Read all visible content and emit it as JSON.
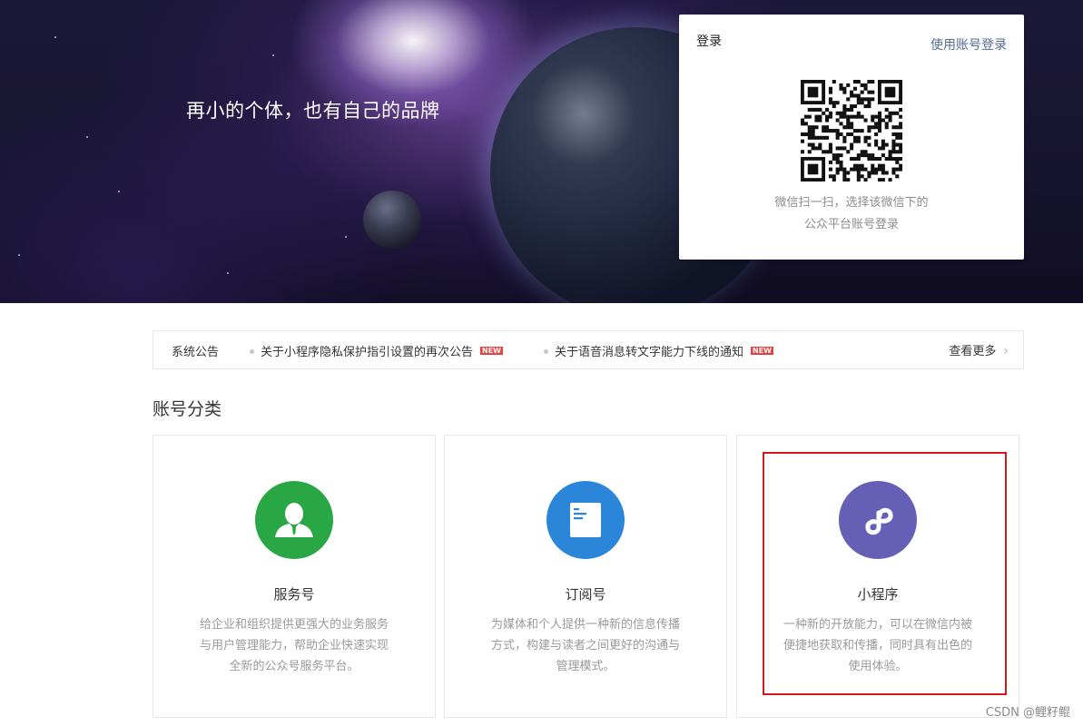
{
  "banner": {
    "slogan": "再小的个体，也有自己的品牌"
  },
  "login": {
    "title": "登录",
    "switch_link": "使用账号登录",
    "tip_line1": "微信扫一扫，选择该微信下的",
    "tip_line2": "公众平台账号登录"
  },
  "notice": {
    "label": "系统公告",
    "items": [
      {
        "text": "关于小程序隐私保护指引设置的再次公告",
        "tag": "NEW"
      },
      {
        "text": "关于语音消息转文字能力下线的通知",
        "tag": "NEW"
      }
    ],
    "more": "查看更多"
  },
  "section": {
    "title": "账号分类"
  },
  "cards": [
    {
      "name": "服务号",
      "icon": "user-suit-icon",
      "color": "#2aa745",
      "desc": [
        "给企业和组织提供更强大的业务服务",
        "与用户管理能力，帮助企业快速实现",
        "全新的公众号服务平台。"
      ]
    },
    {
      "name": "订阅号",
      "icon": "document-icon",
      "color": "#2b86da",
      "desc": [
        "为媒体和个人提供一种新的信息传播",
        "方式，构建与读者之间更好的沟通与",
        "管理模式。"
      ]
    },
    {
      "name": "小程序",
      "icon": "mini-program-icon",
      "color": "#6560b5",
      "desc": [
        "一种新的开放能力，可以在微信内被",
        "便捷地获取和传播，同时具有出色的",
        "使用体验。"
      ]
    }
  ],
  "watermark": "CSDN @鲤籽鲲"
}
